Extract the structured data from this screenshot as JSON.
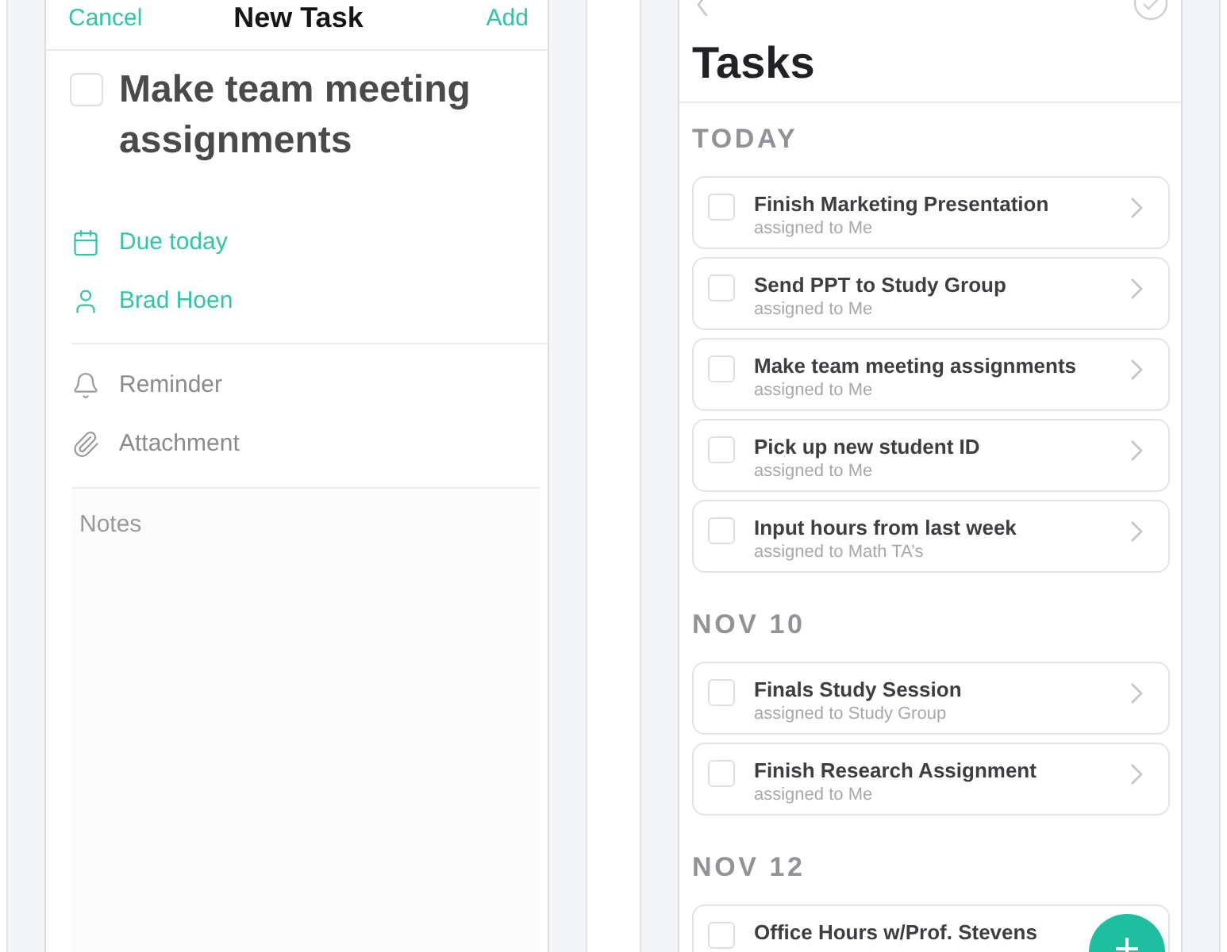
{
  "new_task": {
    "cancel": "Cancel",
    "title": "New Task",
    "add": "Add",
    "task": {
      "title": "Make team meeting assignments",
      "checked": false
    },
    "details": [
      {
        "kind": "due",
        "label": "Due today",
        "set": true
      },
      {
        "kind": "assignee",
        "label": "Brad Hoen",
        "set": true
      }
    ],
    "extras": [
      {
        "kind": "reminder",
        "label": "Reminder",
        "set": false
      },
      {
        "kind": "attachment",
        "label": "Attachment",
        "set": false
      }
    ],
    "notes": {
      "placeholder": "Notes"
    }
  },
  "tasks_screen": {
    "title": "Tasks",
    "sections": [
      {
        "heading": "TODAY",
        "tasks": [
          {
            "title": "Finish Marketing Presentation",
            "assignee": "assigned to Me",
            "checked": false
          },
          {
            "title": "Send PPT to Study Group",
            "assignee": "assigned to Me",
            "checked": false
          },
          {
            "title": "Make team meeting assignments",
            "assignee": "assigned to Me",
            "checked": false
          },
          {
            "title": "Pick up new student ID",
            "assignee": "assigned to Me",
            "checked": false
          },
          {
            "title": "Input hours from last week",
            "assignee": "assigned to Math TA’s",
            "checked": false
          }
        ]
      },
      {
        "heading": "NOV 10",
        "tasks": [
          {
            "title": "Finals Study Session",
            "assignee": "assigned to Study Group",
            "checked": false
          },
          {
            "title": "Finish Research Assignment",
            "assignee": "assigned to Me",
            "checked": false
          }
        ]
      },
      {
        "heading": "NOV 12",
        "tasks": [
          {
            "title": "Office Hours w/Prof. Stevens",
            "checked": false
          }
        ]
      }
    ]
  }
}
